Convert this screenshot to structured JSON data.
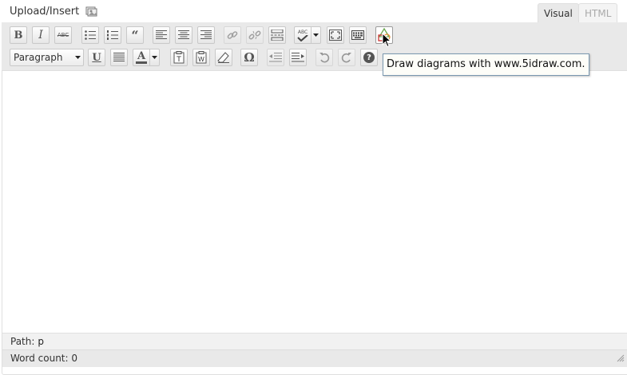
{
  "header": {
    "upload_label": "Upload/Insert",
    "upload_icon": "media-icon"
  },
  "tabs": [
    {
      "label": "Visual",
      "active": true
    },
    {
      "label": "HTML",
      "active": false
    }
  ],
  "toolbar": {
    "row1": [
      {
        "id": "bold",
        "label": "B",
        "icon": "bold-icon"
      },
      {
        "id": "italic",
        "label": "I",
        "icon": "italic-icon"
      },
      {
        "id": "strikethrough",
        "label": "ABC",
        "icon": "strikethrough-icon"
      },
      {
        "id": "bullet-list",
        "icon": "bullet-list-icon"
      },
      {
        "id": "numbered-list",
        "icon": "numbered-list-icon"
      },
      {
        "id": "blockquote",
        "label": "“",
        "icon": "blockquote-icon"
      },
      {
        "id": "align-left",
        "icon": "align-left-icon"
      },
      {
        "id": "align-center",
        "icon": "align-center-icon"
      },
      {
        "id": "align-right",
        "icon": "align-right-icon"
      },
      {
        "id": "insert-link",
        "icon": "link-icon"
      },
      {
        "id": "unlink",
        "icon": "unlink-icon"
      },
      {
        "id": "insert-more",
        "icon": "more-tag-icon"
      },
      {
        "id": "spellcheck",
        "label": "ABC",
        "icon": "spellcheck-icon"
      },
      {
        "id": "fullscreen",
        "icon": "fullscreen-icon"
      },
      {
        "id": "kitchen-sink",
        "icon": "kitchen-sink-icon"
      },
      {
        "id": "draw-diagram",
        "icon": "diagram-icon"
      }
    ],
    "row2": [
      {
        "id": "underline",
        "label": "U",
        "icon": "underline-icon"
      },
      {
        "id": "justify",
        "icon": "justify-icon"
      },
      {
        "id": "text-color",
        "label": "A",
        "icon": "text-color-icon"
      },
      {
        "id": "paste-text",
        "label": "T",
        "icon": "paste-text-icon"
      },
      {
        "id": "paste-word",
        "label": "W",
        "icon": "paste-word-icon"
      },
      {
        "id": "remove-format",
        "icon": "eraser-icon"
      },
      {
        "id": "special-char",
        "label": "Ω",
        "icon": "omega-icon"
      },
      {
        "id": "outdent",
        "icon": "outdent-icon"
      },
      {
        "id": "indent",
        "icon": "indent-icon"
      },
      {
        "id": "undo",
        "icon": "undo-icon"
      },
      {
        "id": "redo",
        "icon": "redo-icon"
      },
      {
        "id": "help",
        "label": "?",
        "icon": "help-icon"
      }
    ],
    "format_select": {
      "value": "Paragraph"
    },
    "tooltip": "Draw diagrams with www.5idraw.com."
  },
  "path_bar": {
    "label": "Path:",
    "value": "p"
  },
  "status": {
    "word_count": "Word count: 0"
  }
}
